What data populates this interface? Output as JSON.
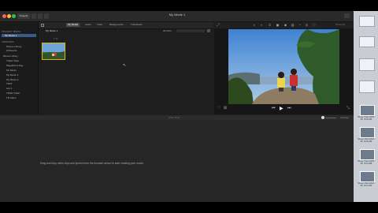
{
  "window": {
    "title": "My Movie 1"
  },
  "toolbar": {
    "projects_label": "Projects"
  },
  "browser": {
    "tabs": [
      "My Media",
      "Audio",
      "Titles",
      "Backgrounds",
      "Transitions"
    ],
    "active_tab": "My Media",
    "filter_label": "All Clips",
    "event_title": "My Movie 1",
    "clip_duration": "1.7s"
  },
  "sidebar": {
    "heading_project": "PROJECT MEDIA",
    "project_item": "My Movie 1",
    "heading_libraries": "LIBRARIES",
    "items": [
      "Photos Library",
      "All Events",
      "iMovie Library",
      "Trailer Clips",
      "Magnificent Day",
      "My Movie",
      "My Movie 1",
      "My Movie 2",
      "TEST",
      "test 1",
      "TRUE Trailer",
      "TR Video"
    ]
  },
  "viewer": {
    "zoom_label": "Reset All"
  },
  "timeline": {
    "time_label": "0:00 / 0:14",
    "settings_label": "Settings",
    "drop_hint": "Drag and drop video clips and photos from the browser above to start creating your movie."
  },
  "dock": {
    "items": [
      {
        "label": "Screen Shot 2018-05...8.40 AM"
      },
      {
        "label": "Screen Shot 2018-05...8.40 AM"
      },
      {
        "label": "Screen Shot 2018-05...8.41 AM"
      },
      {
        "label": "Screen Shot 2018-05...8.41 AM"
      }
    ]
  },
  "colors": {
    "accent": "#e0b400",
    "selection": "#3a5a8a"
  }
}
